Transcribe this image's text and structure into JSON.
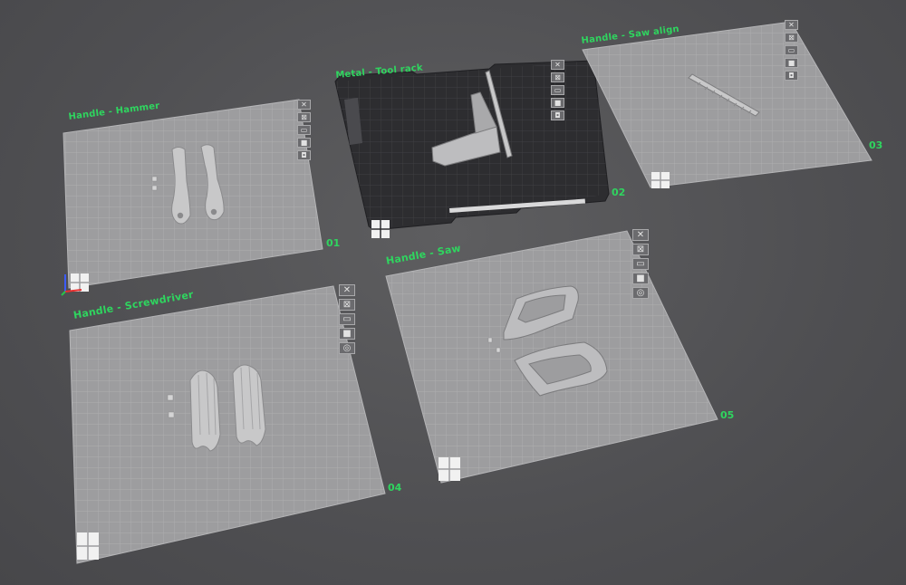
{
  "plates": [
    {
      "id": "01",
      "label": "Handle - Hammer",
      "number": "01"
    },
    {
      "id": "02",
      "label": "Metal - Tool rack",
      "number": "02"
    },
    {
      "id": "03",
      "label": "Handle - Saw align",
      "number": "03"
    },
    {
      "id": "04",
      "label": "Handle - Screwdriver",
      "number": "04"
    },
    {
      "id": "05",
      "label": "Handle - Saw",
      "number": "05"
    }
  ],
  "icons": {
    "close": "close-icon",
    "arrange": "arrange-icon",
    "orient": "orient-icon",
    "lock": "lock-icon",
    "settings": "settings-icon",
    "edit": "edit-icon"
  },
  "colors": {
    "plate": "#9c9c9e",
    "grid": "#b4b4b6",
    "dark_plate": "#2e2e31",
    "label_green": "#2fd55f",
    "background": "#555558"
  }
}
